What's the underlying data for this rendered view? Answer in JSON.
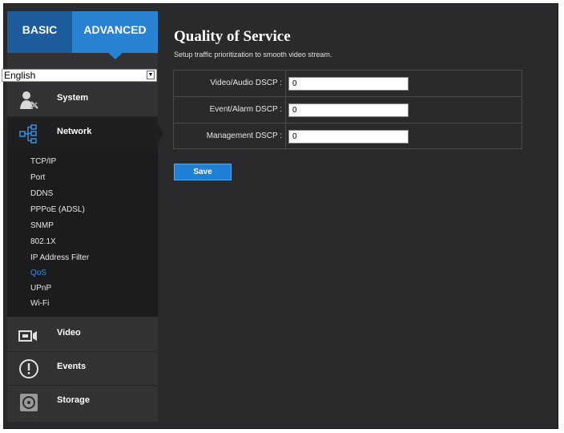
{
  "mode_tabs": {
    "basic": "BASIC",
    "advanced": "ADVANCED"
  },
  "language": {
    "selected": "English"
  },
  "nav": {
    "system": "System",
    "network": "Network",
    "video": "Video",
    "events": "Events",
    "storage": "Storage"
  },
  "network_sub": [
    "TCP/IP",
    "Port",
    "DDNS",
    "PPPoE (ADSL)",
    "SNMP",
    "802.1X",
    "IP Address Filter",
    "QoS",
    "UPnP",
    "Wi-Fi"
  ],
  "page": {
    "title": "Quality of Service",
    "subtitle": "Setup traffic prioritization to smooth video stream."
  },
  "qos": {
    "video_audio_label": "Video/Audio DSCP :",
    "video_audio_value": "0",
    "event_alarm_label": "Event/Alarm DSCP :",
    "event_alarm_value": "0",
    "management_label": "Management DSCP :",
    "management_value": "0"
  },
  "save_label": "Save",
  "colors": {
    "accent": "#2a82d2",
    "active_link": "#3a8ee0",
    "background": "#2a2a2c"
  }
}
